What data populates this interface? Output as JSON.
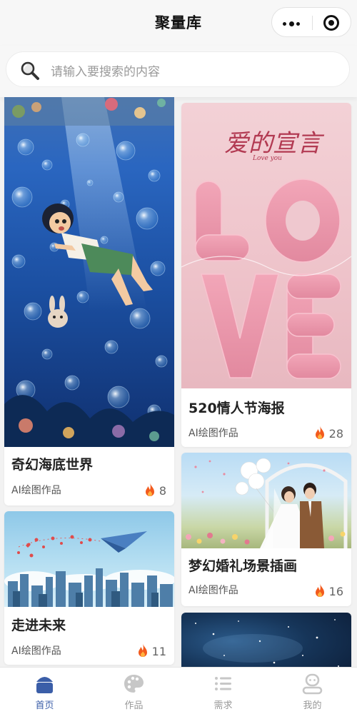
{
  "app": {
    "title": "聚量库"
  },
  "search": {
    "placeholder": "请输入要搜索的内容"
  },
  "feed": {
    "cards": [
      {
        "title": "奇幻海底世界",
        "subtitle": "AI绘图作品",
        "hot_count": "8"
      },
      {
        "title": "520情人节海报",
        "subtitle": "AI绘图作品",
        "hot_count": "28",
        "image_text": {
          "heading": "爱的宣言",
          "script": "Love you",
          "big": "LOVE"
        }
      },
      {
        "title": "走进未来",
        "subtitle": "AI绘图作品",
        "hot_count": "11"
      },
      {
        "title": "梦幻婚礼场景插画",
        "subtitle": "AI绘图作品",
        "hot_count": "16"
      },
      {
        "title": "",
        "subtitle": "",
        "hot_count": ""
      }
    ]
  },
  "tabbar": {
    "items": [
      {
        "label": "首页",
        "icon": "home-icon",
        "active": true
      },
      {
        "label": "作品",
        "icon": "palette-icon",
        "active": false
      },
      {
        "label": "需求",
        "icon": "list-icon",
        "active": false
      },
      {
        "label": "我的",
        "icon": "user-icon",
        "active": false
      }
    ]
  },
  "colors": {
    "accent": "#3b5ea8",
    "flame": "#f25a1d",
    "page_bg": "#f2f2f2"
  }
}
